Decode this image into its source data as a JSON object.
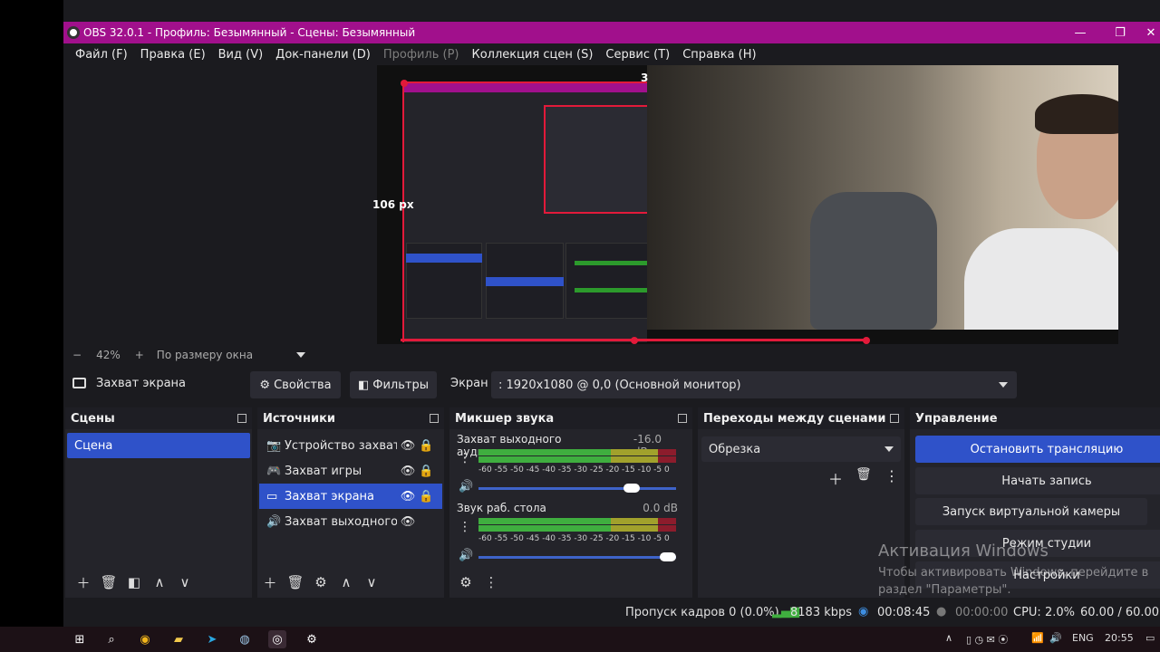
{
  "window": {
    "title": "OBS 32.0.1 - Профиль: Безымянный - Сцены: Безымянный"
  },
  "menu": [
    "Файл (F)",
    "Правка (E)",
    "Вид (V)",
    "Док-панели (D)",
    "Профиль (P)",
    "Коллекция сцен (S)",
    "Сервис (T)",
    "Справка (H)"
  ],
  "preview": {
    "label_px": "106 px",
    "label_num": "3"
  },
  "zoom": {
    "minus": "−",
    "level": "42%",
    "plus": "+",
    "mode": "По размеру окна"
  },
  "source_toolbar": {
    "source_name": "Захват экрана",
    "properties": "Свойства",
    "filters": "Фильтры",
    "screen_label": "Экран",
    "screen_value": ": 1920x1080 @ 0,0 (Основной монитор)"
  },
  "scenes": {
    "title": "Сцены",
    "items": [
      "Сцена"
    ]
  },
  "sources": {
    "title": "Источники",
    "items": [
      "Устройство захвата",
      "Захват игры",
      "Захват экрана",
      "Захват выходного а"
    ]
  },
  "mixer": {
    "title": "Микшер звука",
    "channels": [
      {
        "name": "Захват выходного аудиопотока",
        "db": "-16.0 dB",
        "volume_pct": 80
      },
      {
        "name": "Звук раб. стола",
        "db": "0.0 dB",
        "volume_pct": 100
      }
    ],
    "scale": "-60 -55 -50 -45 -40 -35 -30 -25 -20 -15 -10 -5  0"
  },
  "transitions": {
    "title": "Переходы между сценами",
    "selected": "Обрезка"
  },
  "controls": {
    "title": "Управление",
    "buttons": [
      "Остановить трансляцию",
      "Начать запись",
      "Запуск виртуальной камеры",
      "Режим студии",
      "Настройки"
    ]
  },
  "watermark": {
    "title": "Активация Windows",
    "line1": "Чтобы активировать Windows, перейдите в",
    "line2": "раздел \"Параметры\"."
  },
  "status": {
    "dropped": "Пропуск кадров 0 (0.0%)",
    "kbps": "8183 kbps",
    "stream_time": "00:08:45",
    "rec_time": "00:00:00",
    "cpu": "CPU: 2.0%",
    "fps": "60.00 / 60.00 FPS"
  },
  "taskbar": {
    "lang": "ENG",
    "time": "20:55"
  },
  "colors": {
    "title_bg": "#a1108c",
    "accent": "#2f52c9",
    "selection_red": "#e21a3a"
  }
}
